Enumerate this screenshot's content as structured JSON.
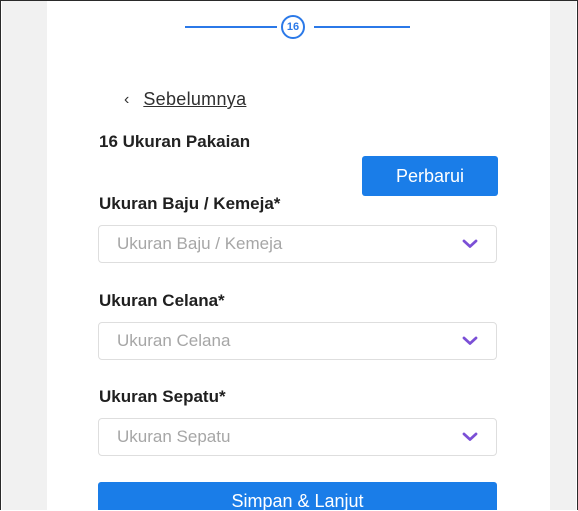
{
  "stepper": {
    "current_step": "16"
  },
  "nav": {
    "back_label": "Sebelumnya",
    "back_icon": "chevron-left-icon"
  },
  "section": {
    "title": "16 Ukuran Pakaian"
  },
  "actions": {
    "update_label": "Perbarui",
    "submit_label": "Simpan & Lanjut"
  },
  "fields": [
    {
      "label": "Ukuran Baju / Kemeja*",
      "placeholder": "Ukuran Baju / Kemeja",
      "icon": "chevron-down-icon"
    },
    {
      "label": "Ukuran Celana*",
      "placeholder": "Ukuran Celana",
      "icon": "chevron-down-icon"
    },
    {
      "label": "Ukuran Sepatu*",
      "placeholder": "Ukuran Sepatu",
      "icon": "chevron-down-icon"
    }
  ],
  "colors": {
    "primary": "#1a7de8",
    "chevron": "#7b4fd6",
    "placeholder": "#a6a6a6"
  }
}
